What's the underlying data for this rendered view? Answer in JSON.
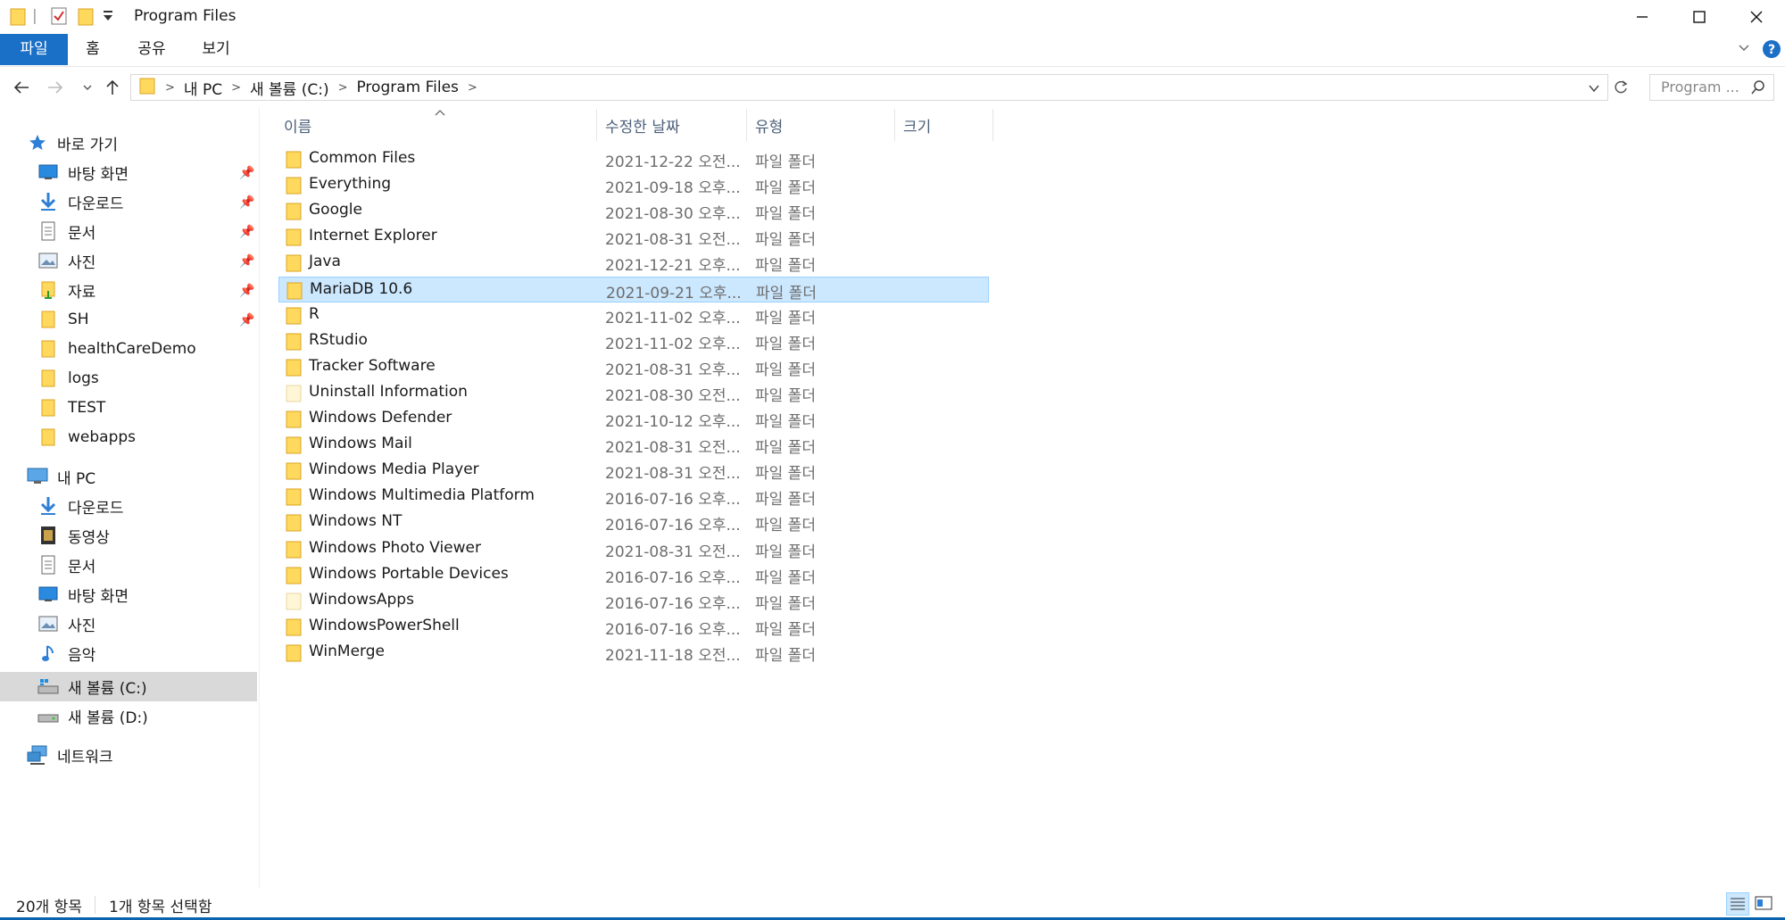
{
  "window": {
    "title": "Program Files"
  },
  "ribbon": {
    "tabs": [
      {
        "label": "파일",
        "active": true
      },
      {
        "label": "홈",
        "active": false
      },
      {
        "label": "공유",
        "active": false
      },
      {
        "label": "보기",
        "active": false
      }
    ]
  },
  "address": {
    "breadcrumbs": [
      "내 PC",
      "새 볼륨 (C:)",
      "Program Files"
    ],
    "search_placeholder": "Program ..."
  },
  "navpane": {
    "quick_access": {
      "label": "바로 가기",
      "icon": "star-icon"
    },
    "quick_items": [
      {
        "label": "바탕 화면",
        "icon": "desktop-icon",
        "pinned": true
      },
      {
        "label": "다운로드",
        "icon": "download-icon",
        "pinned": true
      },
      {
        "label": "문서",
        "icon": "document-icon",
        "pinned": true
      },
      {
        "label": "사진",
        "icon": "picture-icon",
        "pinned": true
      },
      {
        "label": "자료",
        "icon": "folder-icon",
        "pinned": true
      },
      {
        "label": "SH",
        "icon": "folder-icon",
        "pinned": true
      },
      {
        "label": "healthCareDemo",
        "icon": "folder-icon",
        "pinned": false
      },
      {
        "label": "logs",
        "icon": "folder-icon",
        "pinned": false
      },
      {
        "label": "TEST",
        "icon": "folder-icon",
        "pinned": false
      },
      {
        "label": "webapps",
        "icon": "folder-icon",
        "pinned": false
      }
    ],
    "this_pc": {
      "label": "내 PC",
      "icon": "computer-icon"
    },
    "pc_items": [
      {
        "label": "다운로드",
        "icon": "download-icon"
      },
      {
        "label": "동영상",
        "icon": "video-icon"
      },
      {
        "label": "문서",
        "icon": "document-icon"
      },
      {
        "label": "바탕 화면",
        "icon": "desktop-icon"
      },
      {
        "label": "사진",
        "icon": "picture-icon"
      },
      {
        "label": "음악",
        "icon": "music-icon"
      },
      {
        "label": "새 볼륨 (C:)",
        "icon": "drive-icon",
        "selected": true
      },
      {
        "label": "새 볼륨 (D:)",
        "icon": "drive-icon",
        "selected": false
      }
    ],
    "network": {
      "label": "네트워크",
      "icon": "network-icon"
    }
  },
  "columns": {
    "name": "이름",
    "date": "수정한 날짜",
    "type": "유형",
    "size": "크기"
  },
  "files": [
    {
      "name": "Common Files",
      "date": "2021-12-22 오전...",
      "type": "파일 폴더"
    },
    {
      "name": "Everything",
      "date": "2021-09-18 오후...",
      "type": "파일 폴더"
    },
    {
      "name": "Google",
      "date": "2021-08-30 오후...",
      "type": "파일 폴더"
    },
    {
      "name": "Internet Explorer",
      "date": "2021-08-31 오전...",
      "type": "파일 폴더"
    },
    {
      "name": "Java",
      "date": "2021-12-21 오후...",
      "type": "파일 폴더"
    },
    {
      "name": "MariaDB 10.6",
      "date": "2021-09-21 오후...",
      "type": "파일 폴더",
      "selected": true
    },
    {
      "name": "R",
      "date": "2021-11-02 오후...",
      "type": "파일 폴더"
    },
    {
      "name": "RStudio",
      "date": "2021-11-02 오후...",
      "type": "파일 폴더"
    },
    {
      "name": "Tracker Software",
      "date": "2021-08-31 오후...",
      "type": "파일 폴더"
    },
    {
      "name": "Uninstall Information",
      "date": "2021-08-30 오전...",
      "type": "파일 폴더",
      "hidden": true
    },
    {
      "name": "Windows Defender",
      "date": "2021-10-12 오후...",
      "type": "파일 폴더"
    },
    {
      "name": "Windows Mail",
      "date": "2021-08-31 오전...",
      "type": "파일 폴더"
    },
    {
      "name": "Windows Media Player",
      "date": "2021-08-31 오전...",
      "type": "파일 폴더"
    },
    {
      "name": "Windows Multimedia Platform",
      "date": "2016-07-16 오후...",
      "type": "파일 폴더"
    },
    {
      "name": "Windows NT",
      "date": "2016-07-16 오후...",
      "type": "파일 폴더"
    },
    {
      "name": "Windows Photo Viewer",
      "date": "2021-08-31 오전...",
      "type": "파일 폴더"
    },
    {
      "name": "Windows Portable Devices",
      "date": "2016-07-16 오후...",
      "type": "파일 폴더"
    },
    {
      "name": "WindowsApps",
      "date": "2016-07-16 오후...",
      "type": "파일 폴더",
      "hidden": true
    },
    {
      "name": "WindowsPowerShell",
      "date": "2016-07-16 오후...",
      "type": "파일 폴더"
    },
    {
      "name": "WinMerge",
      "date": "2021-11-18 오전...",
      "type": "파일 폴더"
    }
  ],
  "status": {
    "item_count": "20개 항목",
    "selected_count": "1개 항목 선택함"
  },
  "colors": {
    "accent": "#1a6fc6",
    "selection": "#cce8ff",
    "folder": "#ffd85e"
  }
}
